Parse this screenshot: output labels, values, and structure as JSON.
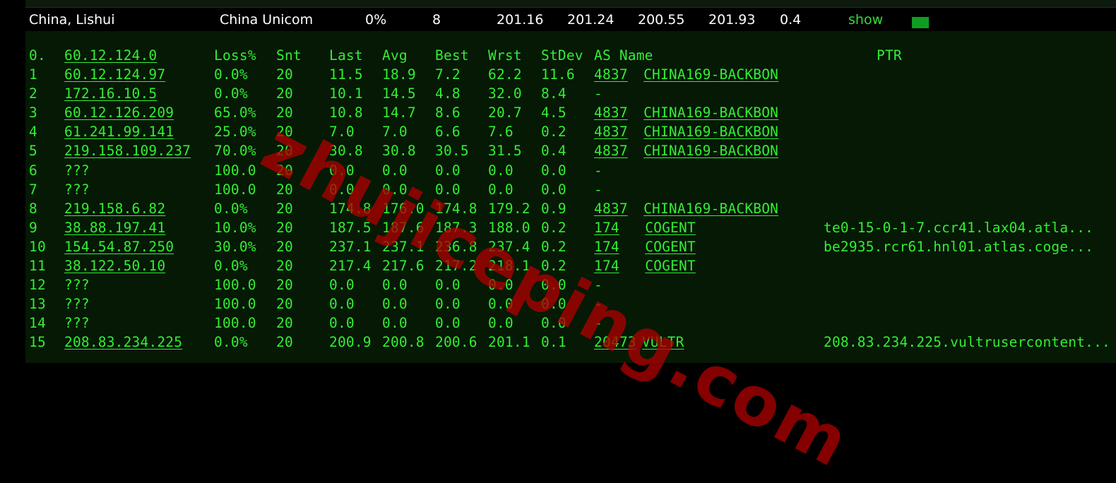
{
  "summary": {
    "location": "China, Lishui",
    "isp": "China Unicom",
    "loss": "0%",
    "sent": "8",
    "last": "201.16",
    "avg": "201.24",
    "best": "200.55",
    "worst": "201.93",
    "stdev": "0.4",
    "show_label": "show",
    "status_color": "#0f9d1f"
  },
  "mtr": {
    "headers": {
      "hop": "0.",
      "host": "60.12.124.0",
      "loss": "Loss%",
      "snt": "Snt",
      "last": "Last",
      "avg": "Avg",
      "best": "Best",
      "wrst": "Wrst",
      "stdev": "StDev",
      "as_name": "AS Name",
      "ptr": "PTR"
    },
    "rows": [
      {
        "hop": "1",
        "host": "60.12.124.97",
        "loss": "0.0%",
        "snt": "20",
        "last": "11.5",
        "avg": "18.9",
        "best": "7.2",
        "wrst": "62.2",
        "stdev": "11.6",
        "asn": "4837",
        "asname": "CHINA169-BACKBON",
        "ptr": ""
      },
      {
        "hop": "2",
        "host": "172.16.10.5",
        "loss": "0.0%",
        "snt": "20",
        "last": "10.1",
        "avg": "14.5",
        "best": "4.8",
        "wrst": "32.0",
        "stdev": "8.4",
        "asn": "-",
        "asname": "",
        "ptr": ""
      },
      {
        "hop": "3",
        "host": "60.12.126.209",
        "loss": "65.0%",
        "snt": "20",
        "last": "10.8",
        "avg": "14.7",
        "best": "8.6",
        "wrst": "20.7",
        "stdev": "4.5",
        "asn": "4837",
        "asname": "CHINA169-BACKBON",
        "ptr": ""
      },
      {
        "hop": "4",
        "host": "61.241.99.141",
        "loss": "25.0%",
        "snt": "20",
        "last": "7.0",
        "avg": "7.0",
        "best": "6.6",
        "wrst": "7.6",
        "stdev": "0.2",
        "asn": "4837",
        "asname": "CHINA169-BACKBON",
        "ptr": ""
      },
      {
        "hop": "5",
        "host": "219.158.109.237",
        "loss": "70.0%",
        "snt": "20",
        "last": "30.8",
        "avg": "30.8",
        "best": "30.5",
        "wrst": "31.5",
        "stdev": "0.4",
        "asn": "4837",
        "asname": "CHINA169-BACKBON",
        "ptr": ""
      },
      {
        "hop": "6",
        "host": "???",
        "loss": "100.0",
        "snt": "20",
        "last": "0.0",
        "avg": "0.0",
        "best": "0.0",
        "wrst": "0.0",
        "stdev": "0.0",
        "asn": "-",
        "asname": "",
        "ptr": ""
      },
      {
        "hop": "7",
        "host": "???",
        "loss": "100.0",
        "snt": "20",
        "last": "0.0",
        "avg": "0.0",
        "best": "0.0",
        "wrst": "0.0",
        "stdev": "0.0",
        "asn": "-",
        "asname": "",
        "ptr": ""
      },
      {
        "hop": "8",
        "host": "219.158.6.82",
        "loss": "0.0%",
        "snt": "20",
        "last": "174.8",
        "avg": "176.0",
        "best": "174.8",
        "wrst": "179.2",
        "stdev": "0.9",
        "asn": "4837",
        "asname": "CHINA169-BACKBON",
        "ptr": ""
      },
      {
        "hop": "9",
        "host": "38.88.197.41",
        "loss": "10.0%",
        "snt": "20",
        "last": "187.5",
        "avg": "187.6",
        "best": "187.3",
        "wrst": "188.0",
        "stdev": "0.2",
        "asn": "174",
        "asname": "COGENT",
        "ptr": "te0-15-0-1-7.ccr41.lax04.atla..."
      },
      {
        "hop": "10",
        "host": "154.54.87.250",
        "loss": "30.0%",
        "snt": "20",
        "last": "237.1",
        "avg": "237.1",
        "best": "236.8",
        "wrst": "237.4",
        "stdev": "0.2",
        "asn": "174",
        "asname": "COGENT",
        "ptr": "be2935.rcr61.hnl01.atlas.coge..."
      },
      {
        "hop": "11",
        "host": "38.122.50.10",
        "loss": "0.0%",
        "snt": "20",
        "last": "217.4",
        "avg": "217.6",
        "best": "217.2",
        "wrst": "218.1",
        "stdev": "0.2",
        "asn": "174",
        "asname": "COGENT",
        "ptr": ""
      },
      {
        "hop": "12",
        "host": "???",
        "loss": "100.0",
        "snt": "20",
        "last": "0.0",
        "avg": "0.0",
        "best": "0.0",
        "wrst": "0.0",
        "stdev": "0.0",
        "asn": "-",
        "asname": "",
        "ptr": ""
      },
      {
        "hop": "13",
        "host": "???",
        "loss": "100.0",
        "snt": "20",
        "last": "0.0",
        "avg": "0.0",
        "best": "0.0",
        "wrst": "0.0",
        "stdev": "0.0",
        "asn": "-",
        "asname": "",
        "ptr": ""
      },
      {
        "hop": "14",
        "host": "???",
        "loss": "100.0",
        "snt": "20",
        "last": "0.0",
        "avg": "0.0",
        "best": "0.0",
        "wrst": "0.0",
        "stdev": "0.0",
        "asn": "-",
        "asname": "",
        "ptr": ""
      },
      {
        "hop": "15",
        "host": "208.83.234.225",
        "loss": "0.0%",
        "snt": "20",
        "last": "200.9",
        "avg": "200.8",
        "best": "200.6",
        "wrst": "201.1",
        "stdev": "0.1",
        "asn": "20473",
        "asname": "VULTR",
        "ptr": "208.83.234.225.vultrusercontent..."
      }
    ]
  },
  "watermark": {
    "text": "zhujiceping.com",
    "color": "#aa0000"
  }
}
